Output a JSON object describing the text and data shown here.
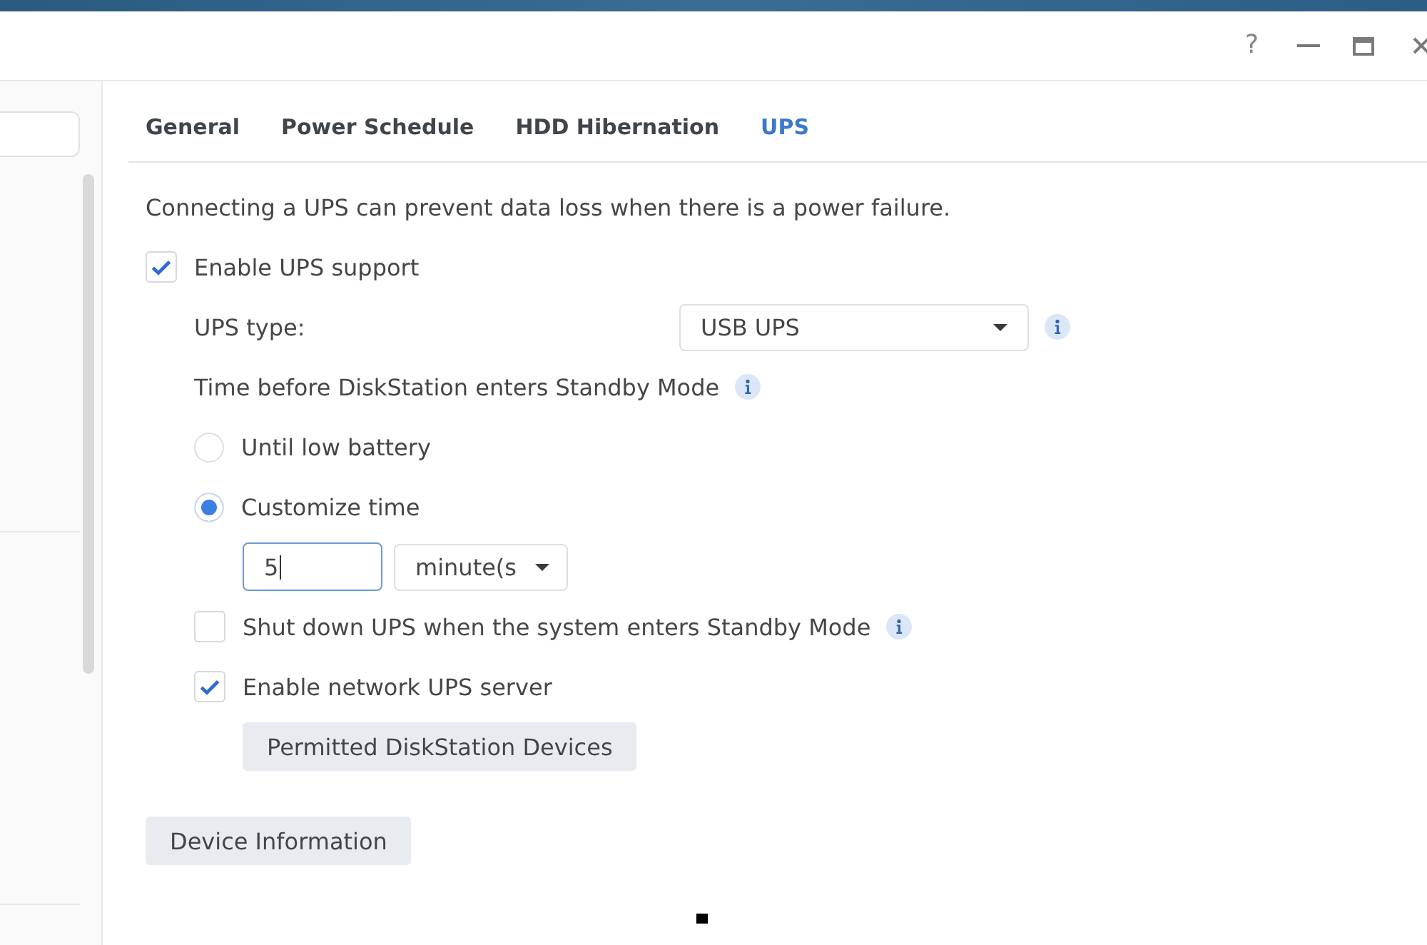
{
  "title_bar": {
    "help": "?"
  },
  "tabs": [
    {
      "label": "General",
      "selected": false
    },
    {
      "label": "Power Schedule",
      "selected": false
    },
    {
      "label": "HDD Hibernation",
      "selected": false
    },
    {
      "label": "UPS",
      "selected": true
    }
  ],
  "ups_tab": {
    "description": "Connecting a UPS can prevent data loss when there is a power failure.",
    "options": [
      {
        "kind": "checkbox",
        "label": "Enable UPS support",
        "checked": true,
        "children": [
          {
            "kind": "select",
            "label": "UPS type:",
            "value": "USB UPS",
            "info": true
          },
          {
            "kind": "text",
            "label": "Time before DiskStation enters Standby Mode",
            "info": true
          },
          {
            "kind": "radio",
            "label": "Until low battery",
            "selected": false
          },
          {
            "kind": "radio",
            "label": "Customize time",
            "selected": true,
            "children": [
              {
                "kind": "duration",
                "value": "5",
                "unit": "minute(s"
              }
            ]
          },
          {
            "kind": "checkbox",
            "label": "Shut down UPS when the system enters Standby Mode",
            "checked": false,
            "info": true
          },
          {
            "kind": "checkbox",
            "label": "Enable network UPS server",
            "checked": true,
            "children": [
              {
                "kind": "button",
                "label": "Permitted DiskStation Devices"
              }
            ]
          }
        ]
      }
    ],
    "footer_button": "Device Information"
  }
}
